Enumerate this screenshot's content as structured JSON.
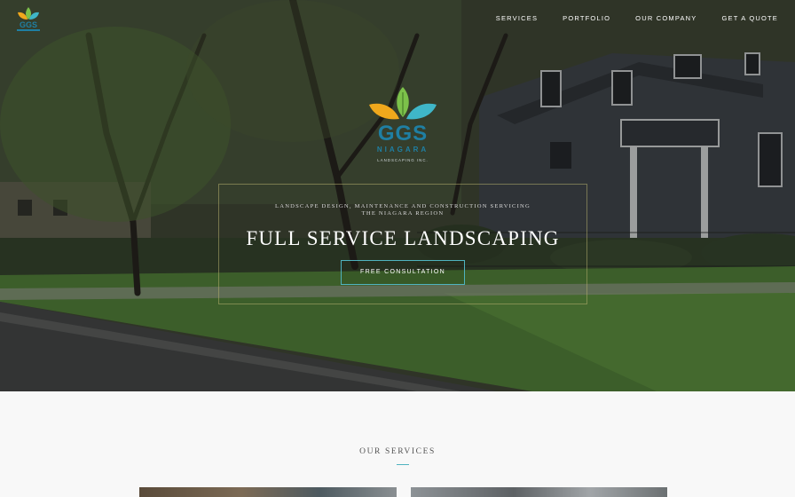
{
  "nav": {
    "items": [
      {
        "label": "SERVICES"
      },
      {
        "label": "PORTFOLIO"
      },
      {
        "label": "OUR COMPANY"
      },
      {
        "label": "GET A QUOTE"
      }
    ]
  },
  "brand": {
    "logo_text": "GGS",
    "logo_sub": "NIAGARA",
    "logo_tag": "LANDSCAPING INC.",
    "colors": {
      "orange": "#f0a81c",
      "green": "#7cc14a",
      "teal": "#3fb6c8",
      "blue": "#1f7fa3"
    }
  },
  "hero": {
    "subline_1": "LANDSCAPE DESIGN, MAINTENANCE AND CONSTRUCTION SERVICING",
    "subline_2": "THE NIAGARA REGION",
    "headline": "FULL SERVICE LANDSCAPING",
    "cta_label": "FREE CONSULTATION",
    "accent_color": "#4fb3bf"
  },
  "services": {
    "title": "OUR SERVICES"
  }
}
